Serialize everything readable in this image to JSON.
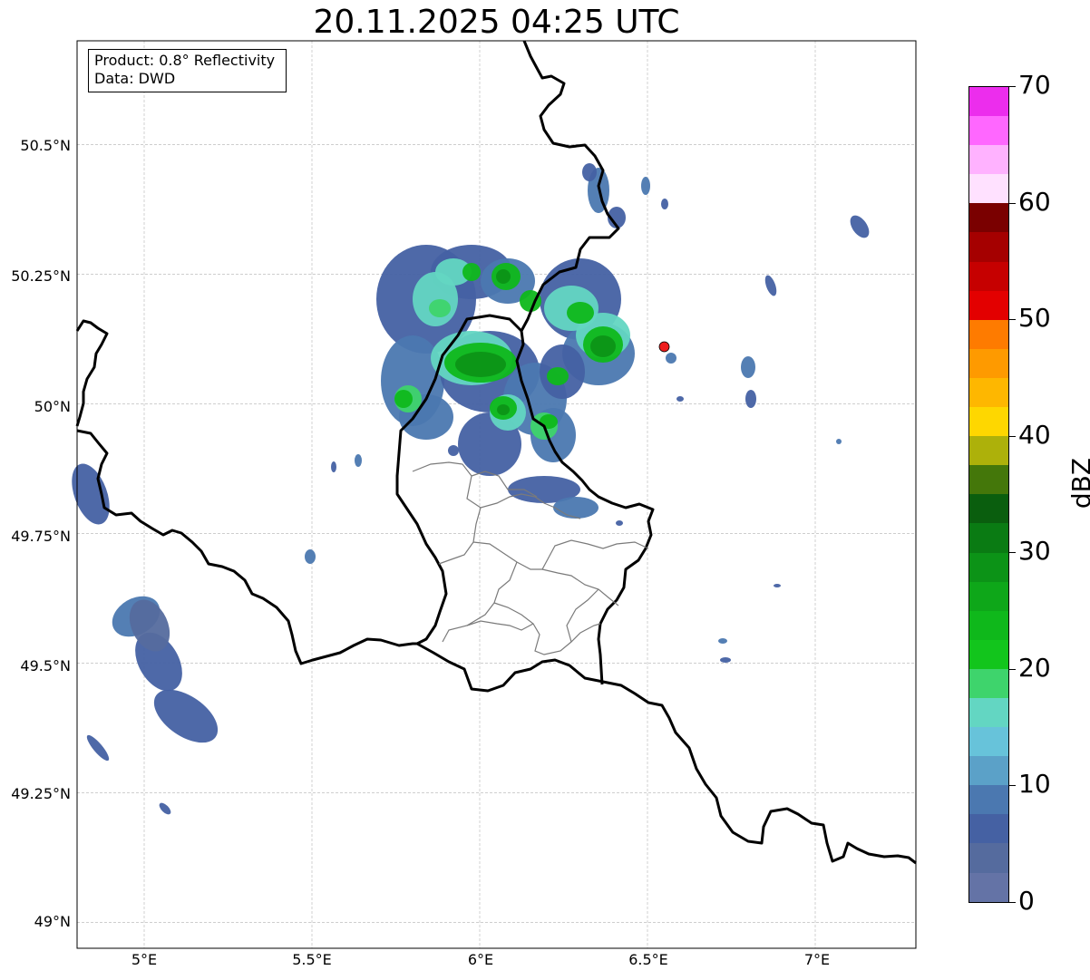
{
  "title": "20.11.2025 04:25 UTC",
  "info": {
    "product": "Product: 0.8° Reflectivity",
    "source": "Data: DWD"
  },
  "axes": {
    "lat_labels": [
      "50.5°N",
      "50.25°N",
      "50°N",
      "49.75°N",
      "49.5°N",
      "49.25°N",
      "49°N"
    ],
    "lon_labels": [
      "5°E",
      "5.5°E",
      "6°E",
      "6.5°E",
      "7°E"
    ],
    "grid": true
  },
  "colorbar": {
    "unit": "dBZ",
    "tick_labels": [
      "0",
      "10",
      "20",
      "30",
      "40",
      "50",
      "60",
      "70"
    ],
    "colors": [
      "#6473a6",
      "#556b9e",
      "#4561a3",
      "#4b78b0",
      "#5ba1c8",
      "#67c3da",
      "#63d6c2",
      "#3ed46c",
      "#12c51c",
      "#0fb81b",
      "#0ea719",
      "#0c9317",
      "#0a7b13",
      "#0a5e0e",
      "#44770a",
      "#adb10a",
      "#fed700",
      "#feb700",
      "#fe9a00",
      "#fe7b00",
      "#e30000",
      "#c60000",
      "#a50000",
      "#7a0000",
      "#ffe1ff",
      "#ffb2ff",
      "#ff67ff",
      "#ec2ded"
    ]
  },
  "marker": {
    "name": "radar site",
    "color": "#ee1c1c"
  },
  "chart_data": {
    "type": "map",
    "title": "20.11.2025 04:25 UTC",
    "xlabel": "",
    "ylabel": "",
    "xlim": [
      4.8,
      7.3
    ],
    "ylim": [
      48.95,
      50.7
    ],
    "x_ticks": [
      5.0,
      5.5,
      6.0,
      6.5,
      7.0
    ],
    "y_ticks": [
      49.0,
      49.25,
      49.5,
      49.75,
      50.0,
      50.25,
      50.5
    ],
    "colorbar": {
      "label": "dBZ",
      "min": 0,
      "max": 70,
      "ticks": [
        0,
        10,
        20,
        30,
        40,
        50,
        60,
        70
      ],
      "step": 2.5
    },
    "marker_lonlat": [
      6.55,
      50.11
    ]
  }
}
